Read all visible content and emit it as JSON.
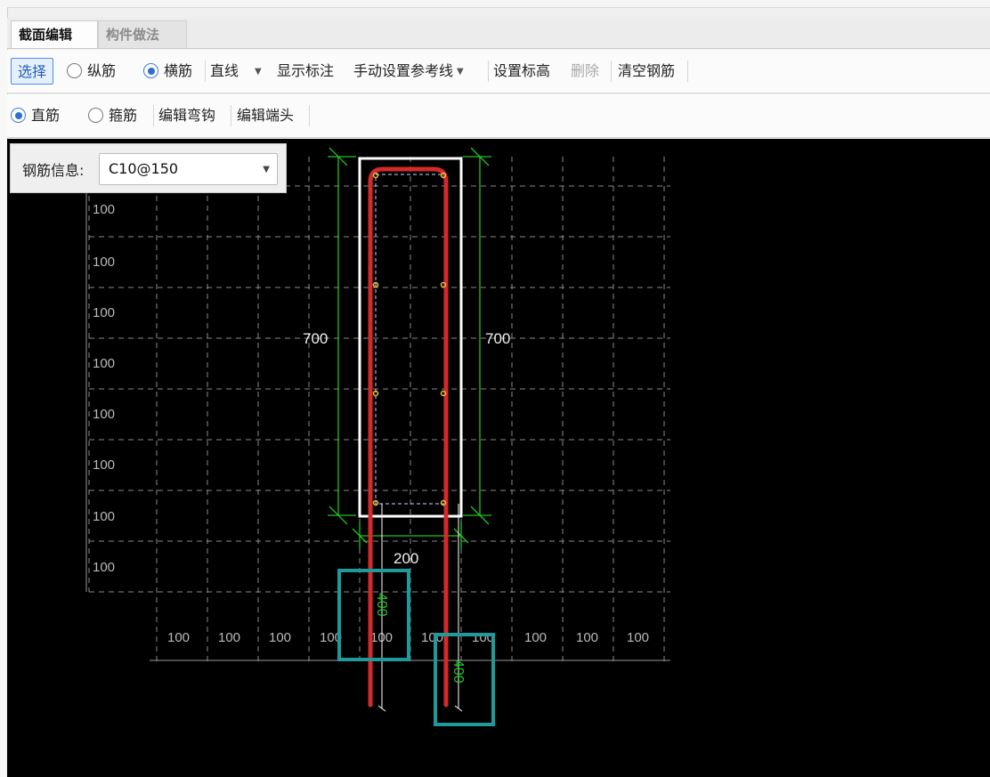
{
  "tabs": [
    "截面编辑",
    "构件做法"
  ],
  "toolbar1": {
    "select": "选择",
    "longitudinal": "纵筋",
    "transverse": "横筋",
    "line_mode": "直线",
    "show_annotation": "显示标注",
    "manual_ref_line": "手动设置参考线",
    "set_elevation": "设置标高",
    "delete": "删除",
    "clear_rebar": "清空钢筋"
  },
  "toolbar2": {
    "straight": "直筋",
    "stirrup": "箍筋",
    "edit_hook": "编辑弯钩",
    "edit_end": "编辑端头"
  },
  "rebar_info": {
    "label": "钢筋信息:",
    "value": "C10@150"
  },
  "drawing": {
    "grid_spacing_label": "100",
    "left_grid_labels": [
      "100",
      "100",
      "100",
      "100",
      "100",
      "100",
      "100",
      "100"
    ],
    "bottom_grid_labels": [
      "100",
      "100",
      "100",
      "100",
      "100",
      "100",
      "100",
      "100",
      "100",
      "100"
    ],
    "dim_left": "700",
    "dim_right": "700",
    "dim_bottom": "200",
    "leg_left": "400",
    "leg_right": "400",
    "colors": {
      "background": "#000000",
      "grid": "#8a8a8a",
      "section": "#ffffff",
      "rebar": "#d42a2a",
      "dimension": "#22c322",
      "highlight": "#1e9a9a"
    }
  }
}
